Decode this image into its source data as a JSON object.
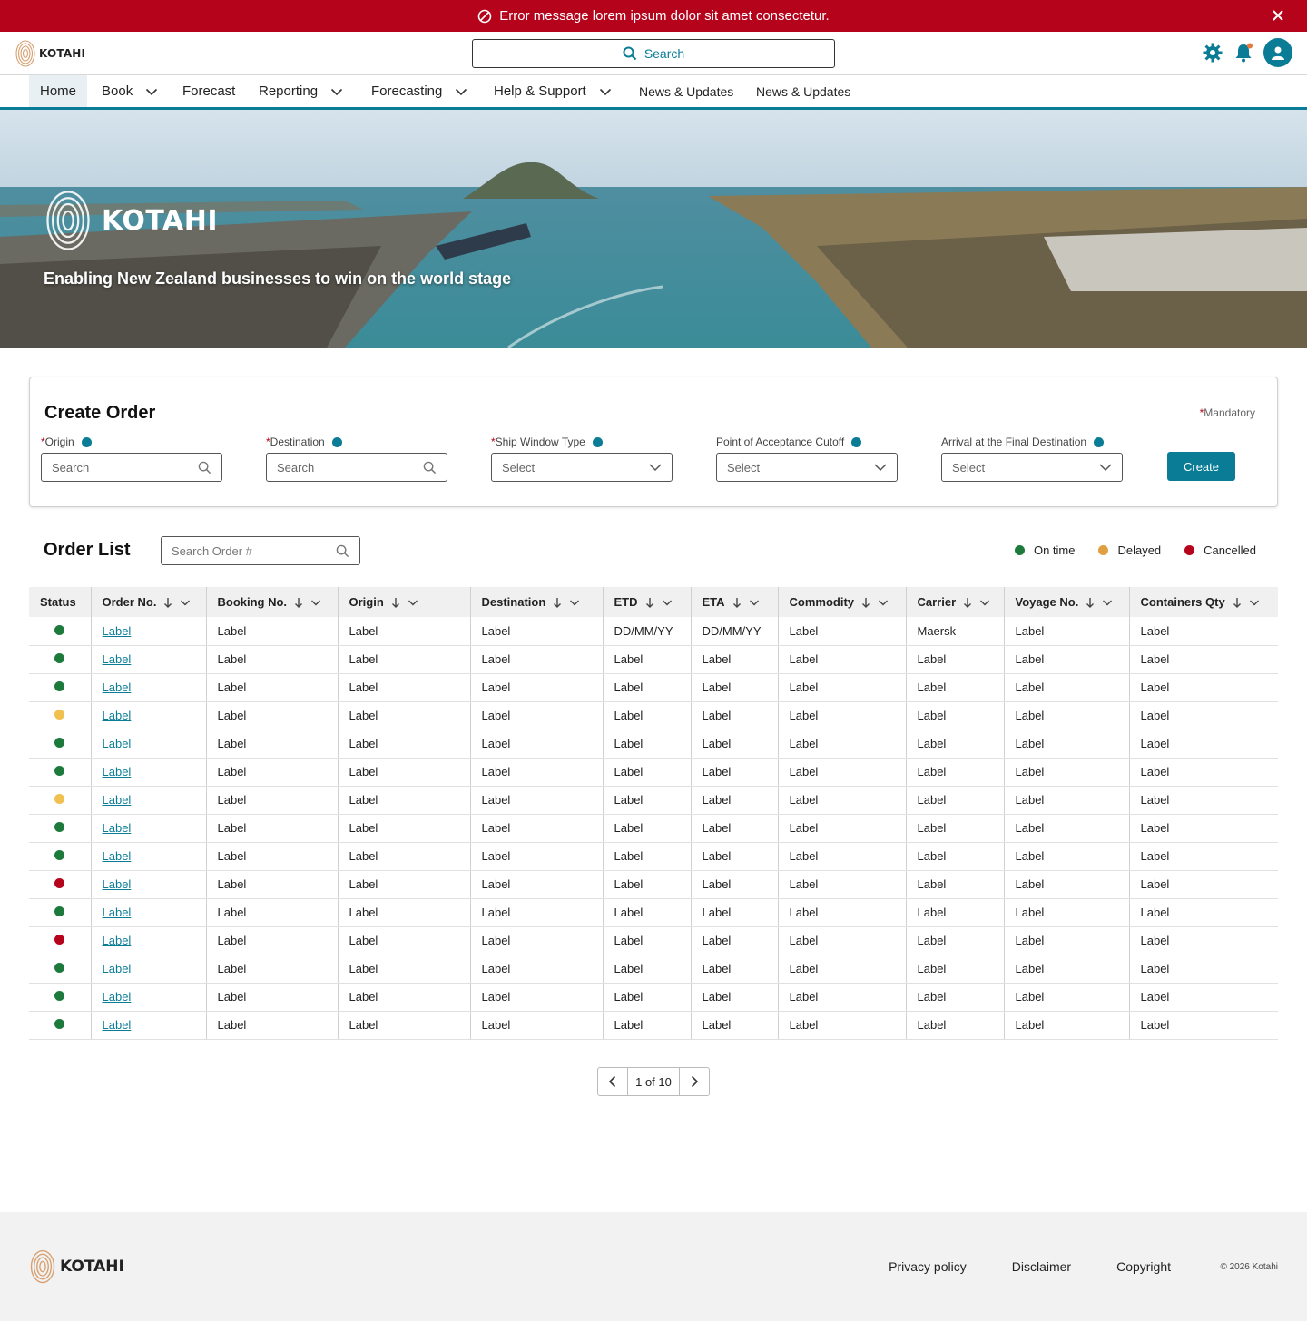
{
  "error_banner": {
    "message": "Error message lorem ipsum dolor sit amet consectetur."
  },
  "header": {
    "logo_text": "KOTAHI",
    "search_placeholder": "Search"
  },
  "nav": {
    "items": [
      {
        "label": "Home",
        "active": true,
        "has_dropdown": false
      },
      {
        "label": "Book",
        "has_dropdown": true
      },
      {
        "label": "Forecast",
        "has_dropdown": false
      },
      {
        "label": "Reporting",
        "has_dropdown": true
      },
      {
        "label": "Forecasting",
        "has_dropdown": true
      },
      {
        "label": "Help & Support",
        "has_dropdown": true
      },
      {
        "label": "News & Updates",
        "has_dropdown": false
      },
      {
        "label": "News & Updates",
        "has_dropdown": false
      }
    ]
  },
  "hero": {
    "brand": "KOTAHI",
    "tagline": "Enabling New Zealand businesses to win on the world stage"
  },
  "create_order": {
    "title": "Create Order",
    "mandatory_note": "Mandatory",
    "fields": [
      {
        "label": "Origin",
        "required": true,
        "placeholder": "Search",
        "kind": "search"
      },
      {
        "label": "Destination",
        "required": true,
        "placeholder": "Search",
        "kind": "search"
      },
      {
        "label": "Ship Window Type",
        "required": true,
        "placeholder": "Select",
        "kind": "select"
      },
      {
        "label": "Point of Acceptance Cutoff",
        "required": false,
        "placeholder": "Select",
        "kind": "select"
      },
      {
        "label": "Arrival at the Final Destination",
        "required": false,
        "placeholder": "Select",
        "kind": "select"
      }
    ],
    "create_label": "Create"
  },
  "order_list": {
    "title": "Order List",
    "search_placeholder": "Search Order #",
    "legend": [
      {
        "label": "On time",
        "color": "#1e7a3c"
      },
      {
        "label": "Delayed",
        "color": "#e0a040"
      },
      {
        "label": "Cancelled",
        "color": "#b5031b"
      }
    ],
    "columns": [
      "Status",
      "Order No.",
      "Booking No.",
      "Origin",
      "Destination",
      "ETD",
      "ETA",
      "Commodity",
      "Carrier",
      "Voyage No.",
      "Containers Qty"
    ],
    "status_colors": {
      "on_time": "#1e7a3c",
      "delayed": "#f0c050",
      "cancelled": "#b5031b"
    },
    "rows": [
      {
        "status": "on_time",
        "cells": [
          "Label",
          "Label",
          "Label",
          "Label",
          "DD/MM/YY",
          "DD/MM/YY",
          "Label",
          "Maersk",
          "Label",
          "Label"
        ]
      },
      {
        "status": "on_time",
        "cells": [
          "Label",
          "Label",
          "Label",
          "Label",
          "Label",
          "Label",
          "Label",
          "Label",
          "Label",
          "Label"
        ]
      },
      {
        "status": "on_time",
        "cells": [
          "Label",
          "Label",
          "Label",
          "Label",
          "Label",
          "Label",
          "Label",
          "Label",
          "Label",
          "Label"
        ]
      },
      {
        "status": "delayed",
        "cells": [
          "Label",
          "Label",
          "Label",
          "Label",
          "Label",
          "Label",
          "Label",
          "Label",
          "Label",
          "Label"
        ]
      },
      {
        "status": "on_time",
        "cells": [
          "Label",
          "Label",
          "Label",
          "Label",
          "Label",
          "Label",
          "Label",
          "Label",
          "Label",
          "Label"
        ]
      },
      {
        "status": "on_time",
        "cells": [
          "Label",
          "Label",
          "Label",
          "Label",
          "Label",
          "Label",
          "Label",
          "Label",
          "Label",
          "Label"
        ]
      },
      {
        "status": "delayed",
        "cells": [
          "Label",
          "Label",
          "Label",
          "Label",
          "Label",
          "Label",
          "Label",
          "Label",
          "Label",
          "Label"
        ]
      },
      {
        "status": "on_time",
        "cells": [
          "Label",
          "Label",
          "Label",
          "Label",
          "Label",
          "Label",
          "Label",
          "Label",
          "Label",
          "Label"
        ]
      },
      {
        "status": "on_time",
        "cells": [
          "Label",
          "Label",
          "Label",
          "Label",
          "Label",
          "Label",
          "Label",
          "Label",
          "Label",
          "Label"
        ]
      },
      {
        "status": "cancelled",
        "cells": [
          "Label",
          "Label",
          "Label",
          "Label",
          "Label",
          "Label",
          "Label",
          "Label",
          "Label",
          "Label"
        ]
      },
      {
        "status": "on_time",
        "cells": [
          "Label",
          "Label",
          "Label",
          "Label",
          "Label",
          "Label",
          "Label",
          "Label",
          "Label",
          "Label"
        ]
      },
      {
        "status": "cancelled",
        "cells": [
          "Label",
          "Label",
          "Label",
          "Label",
          "Label",
          "Label",
          "Label",
          "Label",
          "Label",
          "Label"
        ]
      },
      {
        "status": "on_time",
        "cells": [
          "Label",
          "Label",
          "Label",
          "Label",
          "Label",
          "Label",
          "Label",
          "Label",
          "Label",
          "Label"
        ]
      },
      {
        "status": "on_time",
        "cells": [
          "Label",
          "Label",
          "Label",
          "Label",
          "Label",
          "Label",
          "Label",
          "Label",
          "Label",
          "Label"
        ]
      },
      {
        "status": "on_time",
        "cells": [
          "Label",
          "Label",
          "Label",
          "Label",
          "Label",
          "Label",
          "Label",
          "Label",
          "Label",
          "Label"
        ]
      }
    ]
  },
  "pagination": {
    "text": "1 of 10"
  },
  "footer": {
    "logo_text": "KOTAHI",
    "links": [
      "Privacy policy",
      "Disclaimer",
      "Copyright"
    ],
    "copyright": "© 2026 Kotahi"
  }
}
